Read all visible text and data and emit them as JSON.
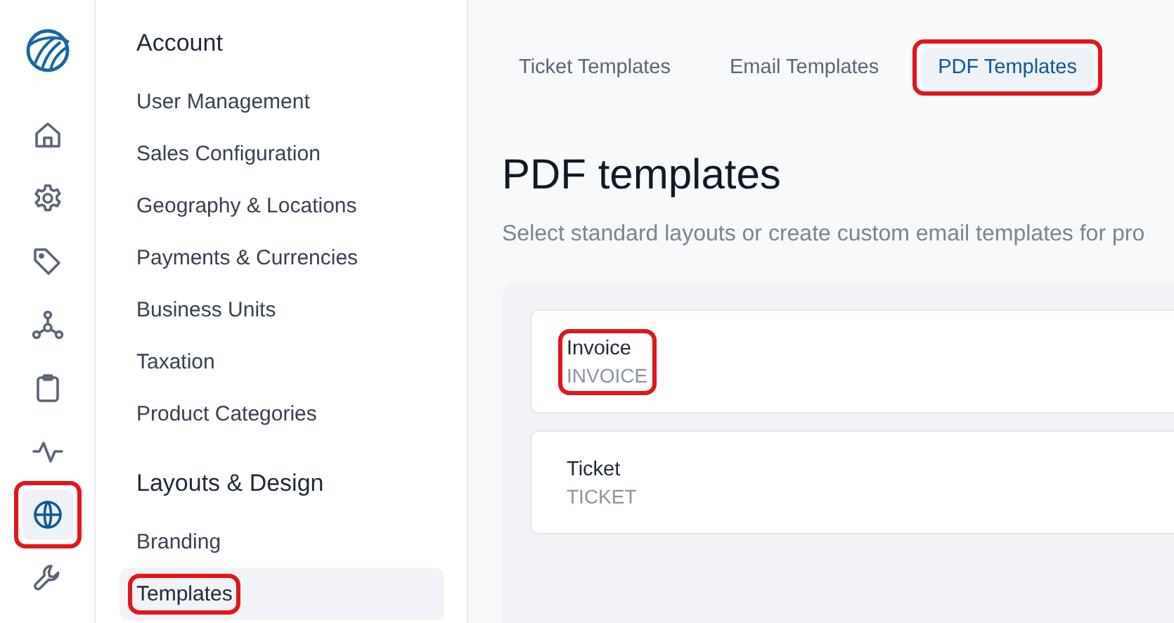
{
  "rail": {
    "items": [
      {
        "kind": "home",
        "selected": false,
        "highlighted": false
      },
      {
        "kind": "settings",
        "selected": false,
        "highlighted": false
      },
      {
        "kind": "tag",
        "selected": false,
        "highlighted": false
      },
      {
        "kind": "network",
        "selected": false,
        "highlighted": false
      },
      {
        "kind": "clipboard",
        "selected": false,
        "highlighted": false
      },
      {
        "kind": "pulse",
        "selected": false,
        "highlighted": false
      },
      {
        "kind": "globe",
        "selected": true,
        "highlighted": true
      },
      {
        "kind": "wrench",
        "selected": false,
        "highlighted": false
      }
    ]
  },
  "nav": {
    "sections": [
      {
        "title": "Account",
        "items": [
          {
            "label": "User Management",
            "selected": false,
            "highlighted": false
          },
          {
            "label": "Sales Configuration",
            "selected": false,
            "highlighted": false
          },
          {
            "label": "Geography & Locations",
            "selected": false,
            "highlighted": false
          },
          {
            "label": "Payments & Currencies",
            "selected": false,
            "highlighted": false
          },
          {
            "label": "Business Units",
            "selected": false,
            "highlighted": false
          },
          {
            "label": "Taxation",
            "selected": false,
            "highlighted": false
          },
          {
            "label": "Product Categories",
            "selected": false,
            "highlighted": false
          }
        ]
      },
      {
        "title": "Layouts & Design",
        "items": [
          {
            "label": "Branding",
            "selected": false,
            "highlighted": false
          },
          {
            "label": "Templates",
            "selected": true,
            "highlighted": true
          }
        ]
      }
    ]
  },
  "tabs": [
    {
      "label": "Ticket Templates",
      "selected": false,
      "highlighted": false
    },
    {
      "label": "Email Templates",
      "selected": false,
      "highlighted": false
    },
    {
      "label": "PDF Templates",
      "selected": true,
      "highlighted": true
    }
  ],
  "page": {
    "title": "PDF templates",
    "subtitle": "Select standard layouts or create custom email templates for pro"
  },
  "templates": [
    {
      "name": "Invoice",
      "code": "INVOICE",
      "highlighted": true
    },
    {
      "name": "Ticket",
      "code": "TICKET",
      "highlighted": false
    }
  ]
}
